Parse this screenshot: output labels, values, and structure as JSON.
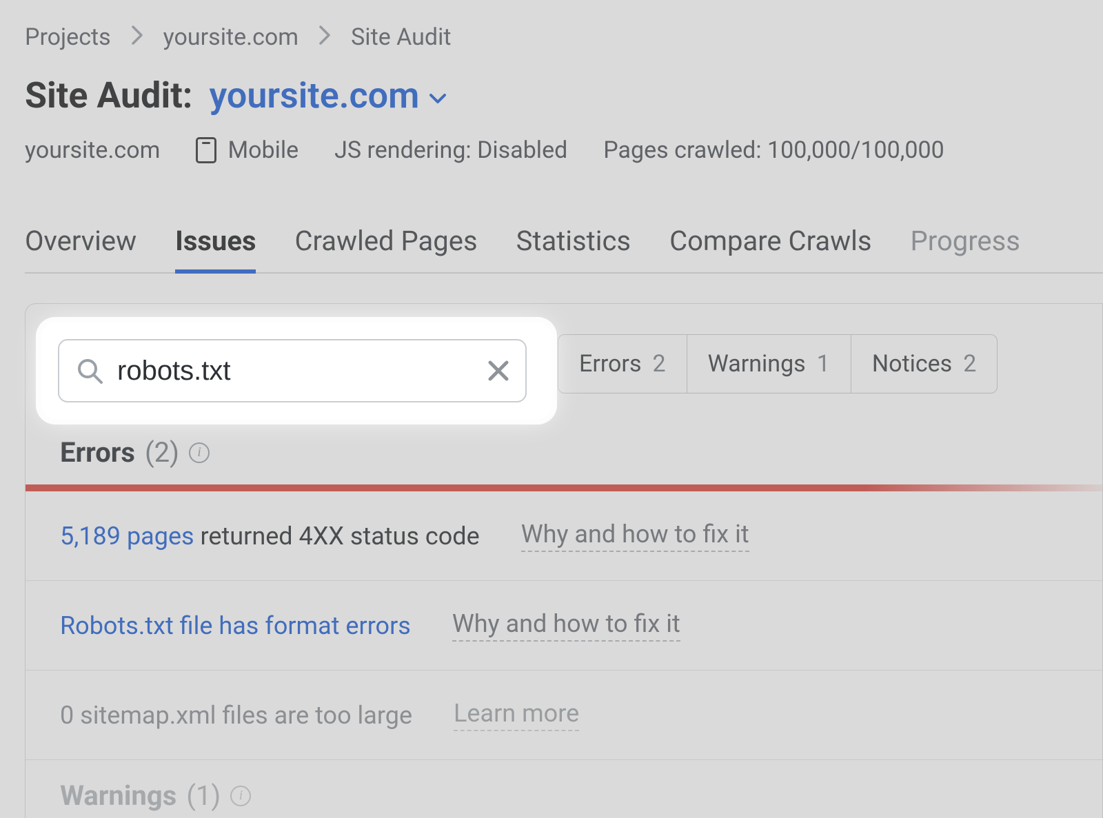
{
  "breadcrumb": {
    "items": [
      "Projects",
      "yoursite.com",
      "Site Audit"
    ]
  },
  "title": {
    "prefix": "Site Audit:",
    "domain": "yoursite.com"
  },
  "meta": {
    "domain": "yoursite.com",
    "device": "Mobile",
    "js_rendering": "JS rendering: Disabled",
    "pages_crawled": "Pages crawled: 100,000/100,000"
  },
  "tabs": [
    "Overview",
    "Issues",
    "Crawled Pages",
    "Statistics",
    "Compare Crawls",
    "Progress"
  ],
  "active_tab_index": 1,
  "search": {
    "value": "robots.txt"
  },
  "filters": {
    "errors": {
      "label": "Errors",
      "count": "2"
    },
    "warnings": {
      "label": "Warnings",
      "count": "1"
    },
    "notices": {
      "label": "Notices",
      "count": "2"
    }
  },
  "sections": {
    "errors_header": {
      "label": "Errors",
      "count_paren": "(2)"
    },
    "warnings_header": {
      "label": "Warnings",
      "count_paren": "(1)"
    }
  },
  "issues": {
    "row1": {
      "link": "5,189 pages",
      "text": " returned 4XX status code",
      "fix": "Why and how to fix it"
    },
    "row2": {
      "link": "Robots.txt file has format errors",
      "fix": "Why and how to fix it"
    },
    "row3": {
      "muted": "0 sitemap.xml files are too large",
      "fix": "Learn more"
    }
  }
}
